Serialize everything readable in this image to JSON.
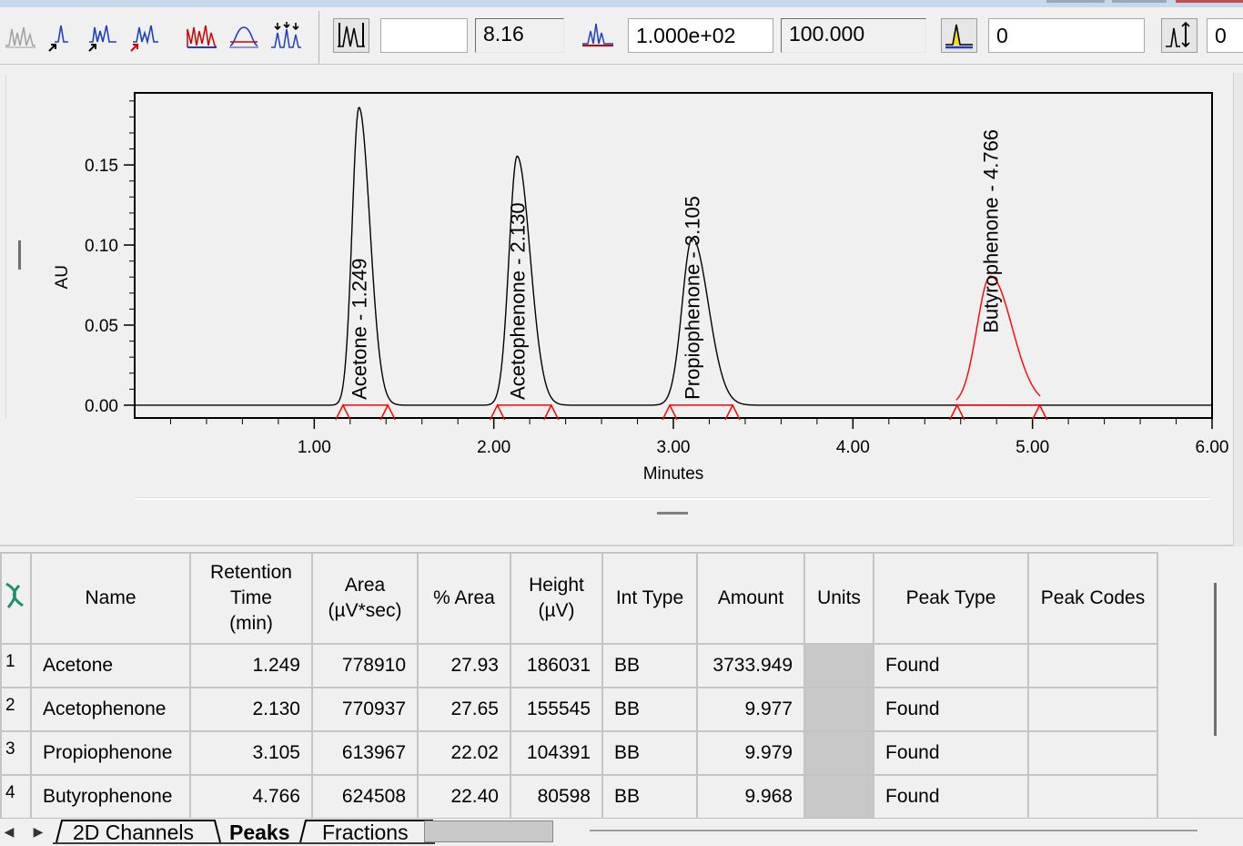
{
  "toolbar": {
    "field_blank": "",
    "field_time": "8.16",
    "field_scale": "1.000e+02",
    "field_percent": "100.000",
    "field_threshold": "0",
    "field_last": "0"
  },
  "chart_data": {
    "type": "line",
    "ylabel": "AU",
    "xlabel": "Minutes",
    "xlim": [
      0.0,
      6.0
    ],
    "ylim": [
      -0.008,
      0.195
    ],
    "x_ticks": [
      "1.00",
      "2.00",
      "3.00",
      "4.00",
      "5.00",
      "6.00"
    ],
    "y_ticks": [
      "0.00",
      "0.05",
      "0.10",
      "0.15"
    ],
    "peaks": [
      {
        "name": "Acetone",
        "rt": 1.249,
        "height": 0.186,
        "sigma": 0.038,
        "start": 1.16,
        "end": 1.41,
        "label": "Acetone - 1.249",
        "color": "#000000"
      },
      {
        "name": "Acetophenone",
        "rt": 2.13,
        "height": 0.1555,
        "sigma": 0.045,
        "start": 2.02,
        "end": 2.32,
        "label": "Acetophenone - 2.130",
        "color": "#000000"
      },
      {
        "name": "Propiophenone",
        "rt": 3.105,
        "height": 0.1044,
        "sigma": 0.056,
        "start": 2.98,
        "end": 3.33,
        "label": "Propiophenone - 3.105",
        "color": "#000000"
      },
      {
        "name": "Butyrophenone",
        "rt": 4.766,
        "height": 0.0806,
        "sigma": 0.075,
        "start": 4.58,
        "end": 5.04,
        "label": "Butyrophenone - 4.766",
        "color": "#ff0000"
      }
    ]
  },
  "table": {
    "headers": {
      "name": "Name",
      "rt_1": "Retention",
      "rt_2": "Time",
      "rt_3": "(min)",
      "area_1": "Area",
      "area_2": "(µV*sec)",
      "pct_area": "% Area",
      "height_1": "Height",
      "height_2": "(µV)",
      "int_type": "Int Type",
      "amount": "Amount",
      "units": "Units",
      "peak_type": "Peak Type",
      "peak_codes": "Peak Codes"
    },
    "rows": [
      {
        "num": "1",
        "name": "Acetone",
        "rt": "1.249",
        "area": "778910",
        "pct": "27.93",
        "height": "186031",
        "int": "BB",
        "amount": "3733.949",
        "units": "",
        "ptype": "Found",
        "codes": ""
      },
      {
        "num": "2",
        "name": "Acetophenone",
        "rt": "2.130",
        "area": "770937",
        "pct": "27.65",
        "height": "155545",
        "int": "BB",
        "amount": "9.977",
        "units": "",
        "ptype": "Found",
        "codes": ""
      },
      {
        "num": "3",
        "name": "Propiophenone",
        "rt": "3.105",
        "area": "613967",
        "pct": "22.02",
        "height": "104391",
        "int": "BB",
        "amount": "9.979",
        "units": "",
        "ptype": "Found",
        "codes": ""
      },
      {
        "num": "4",
        "name": "Butyrophenone",
        "rt": "4.766",
        "area": "624508",
        "pct": "22.40",
        "height": "80598",
        "int": "BB",
        "amount": "9.968",
        "units": "",
        "ptype": "Found",
        "codes": ""
      }
    ]
  },
  "tabs": {
    "channels": "2D Channels",
    "peaks": "Peaks",
    "fractions": "Fractions"
  }
}
